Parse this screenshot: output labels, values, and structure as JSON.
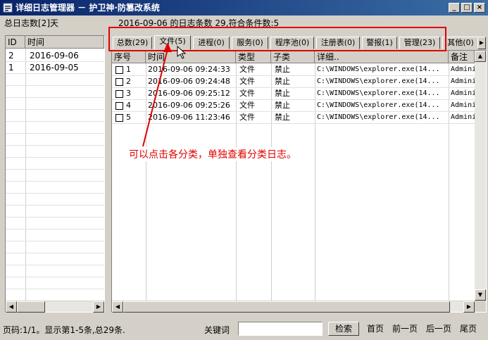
{
  "window": {
    "title": "详细日志管理器 － 护卫神·防篡改系统",
    "controls": {
      "minimize": "_",
      "maximize": "□",
      "close": "×"
    }
  },
  "summary": {
    "total_days": "总日志数[2]天",
    "date_info": "2016-09-06 的日志条数 29,符合条件数:5"
  },
  "date_list": {
    "columns": [
      "ID",
      "时间"
    ],
    "rows": [
      {
        "id": "2",
        "date": "2016-09-06"
      },
      {
        "id": "1",
        "date": "2016-09-05"
      }
    ]
  },
  "tabs": [
    {
      "label": "总数(29)",
      "active": false
    },
    {
      "label": "文件(5)",
      "active": true
    },
    {
      "label": "进程(0)",
      "active": false
    },
    {
      "label": "服务(0)",
      "active": false
    },
    {
      "label": "程序池(0)",
      "active": false
    },
    {
      "label": "注册表(0)",
      "active": false
    },
    {
      "label": "警报(1)",
      "active": false
    },
    {
      "label": "管理(23)",
      "active": false
    },
    {
      "label": "其他(0)",
      "active": false
    }
  ],
  "log_table": {
    "columns": [
      "序号",
      "时间",
      "类型",
      "子类",
      "详细..",
      "备注"
    ],
    "rows": [
      {
        "no": "1",
        "time": "2016-09-06 09:24:33",
        "type": "文件",
        "sub": "禁止",
        "detail": "C:\\WINDOWS\\explorer.exe(14...",
        "note": "Adminis"
      },
      {
        "no": "2",
        "time": "2016-09-06 09:24:48",
        "type": "文件",
        "sub": "禁止",
        "detail": "C:\\WINDOWS\\explorer.exe(14...",
        "note": "Adminis"
      },
      {
        "no": "3",
        "time": "2016-09-06 09:25:12",
        "type": "文件",
        "sub": "禁止",
        "detail": "C:\\WINDOWS\\explorer.exe(14...",
        "note": "Adminis"
      },
      {
        "no": "4",
        "time": "2016-09-06 09:25:26",
        "type": "文件",
        "sub": "禁止",
        "detail": "C:\\WINDOWS\\explorer.exe(14...",
        "note": "Adminis"
      },
      {
        "no": "5",
        "time": "2016-09-06 11:23:46",
        "type": "文件",
        "sub": "禁止",
        "detail": "C:\\WINDOWS\\explorer.exe(14...",
        "note": "Adminis"
      }
    ]
  },
  "annotation": "可以点击各分类，单独查看分类日志。",
  "footer": {
    "page_info": "页码:1/1。显示第1-5条,总29条.",
    "keyword_label": "关键词",
    "keyword_value": "",
    "search_button": "检索",
    "first_page": "首页",
    "prev_page": "前一页",
    "next_page": "后一页",
    "last_page": "尾页"
  },
  "colors": {
    "titlebar": "#0a246a",
    "annotation": "#e00000"
  }
}
